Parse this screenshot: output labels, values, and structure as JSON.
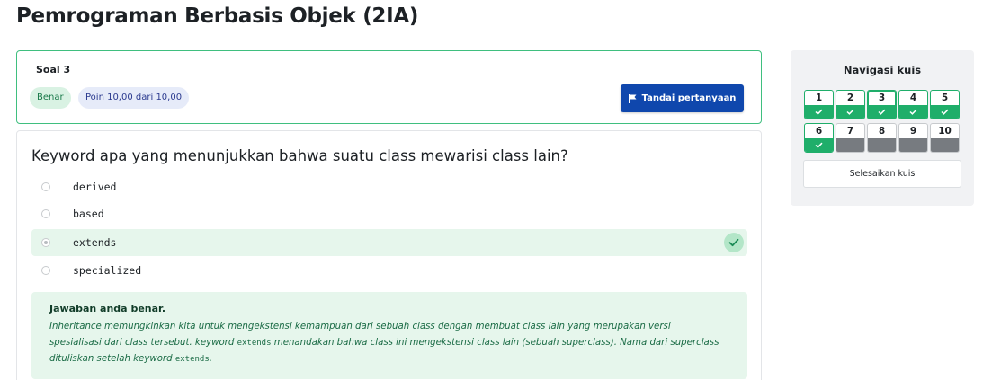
{
  "page": {
    "title": "Pemrograman Berbasis Objek (2IA)"
  },
  "question_info": {
    "number_label": "Soal 3",
    "status_badge": "Benar",
    "points_badge": "Poin 10,00 dari 10,00",
    "flag_button_label": "Tandai pertanyaan",
    "accent_color": "#3fbf7f"
  },
  "question": {
    "text": "Keyword apa yang menunjukkan bahwa suatu class mewarisi class lain?",
    "options": [
      {
        "label": "derived",
        "selected": false
      },
      {
        "label": "based",
        "selected": false
      },
      {
        "label": "extends",
        "selected": true,
        "correct": true
      },
      {
        "label": "specialized",
        "selected": false
      }
    ]
  },
  "feedback": {
    "title": "Jawaban anda benar.",
    "body_part1": "Inheritance memungkinkan kita untuk mengekstensi kemampuan dari sebuah class dengan membuat class lain yang merupakan versi spesialisasi dari class tersebut. keyword ",
    "code1": "extends",
    "body_part2": " menandakan bahwa class ini mengekstensi class lain (sebuah superclass). Nama dari superclass dituliskan setelah keyword ",
    "code2": "extends",
    "body_part3": "."
  },
  "quiz_nav": {
    "title": "Navigasi kuis",
    "buttons": [
      {
        "label": "1",
        "state": "answered"
      },
      {
        "label": "2",
        "state": "answered"
      },
      {
        "label": "3",
        "state": "answered"
      },
      {
        "label": "4",
        "state": "answered"
      },
      {
        "label": "5",
        "state": "answered"
      },
      {
        "label": "6",
        "state": "answered"
      },
      {
        "label": "7",
        "state": "unanswered"
      },
      {
        "label": "8",
        "state": "unanswered"
      },
      {
        "label": "9",
        "state": "unanswered"
      },
      {
        "label": "10",
        "state": "unanswered"
      }
    ],
    "finish_label": "Selesaikan kuis",
    "answered_color": "#1fae6a",
    "unanswered_color": "#777b80"
  },
  "icons": {
    "flag": "flag-icon",
    "check": "check-icon",
    "radio": "radio-icon"
  }
}
